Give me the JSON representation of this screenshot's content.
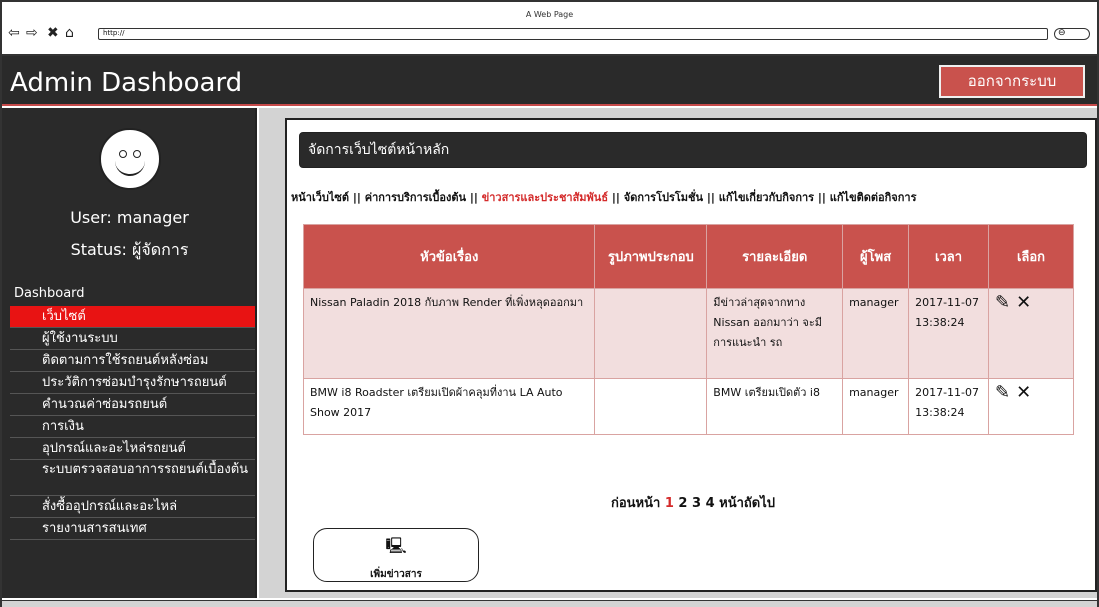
{
  "browser": {
    "title": "A Web Page",
    "url": "http://",
    "back_icon": "back-arrow-icon",
    "forward_icon": "forward-arrow-icon",
    "stop_icon": "close-icon",
    "home_icon": "home-icon",
    "search_icon": "search-icon"
  },
  "header": {
    "title": "Admin Dashboard",
    "logout_label": "ออกจากระบบ",
    "accent": "#c9524d"
  },
  "sidebar": {
    "user_line": "User: manager",
    "status_line": "Status: ผู้จัดการ",
    "section": "Dashboard",
    "items": [
      {
        "label": "เว็บไซต์",
        "active": true
      },
      {
        "label": "ผู้ใช้งานระบบ"
      },
      {
        "label": "ติดตามการใช้รถยนต์หลังซ่อม"
      },
      {
        "label": "ประวัติการซ่อมบำรุงรักษารถยนต์"
      },
      {
        "label": "คำนวณค่าซ่อมรถยนต์"
      },
      {
        "label": "การเงิน"
      },
      {
        "label": "อุปกรณ์และอะไหล่รถยนต์"
      },
      {
        "label": "ระบบตรวจสอบอาการรถยนต์เบื้องต้น"
      },
      {
        "label": "สั่งซื้ออุปกรณ์และอะไหล่"
      },
      {
        "label": "รายงานสารสนเทศ"
      }
    ]
  },
  "main": {
    "panel_title": "จัดการเว็บไซต์หน้าหลัก",
    "tabs": [
      {
        "label": "หน้าเว็บไซต์"
      },
      {
        "label": "ค่าการบริการเบื้องต้น"
      },
      {
        "label": "ข่าวสารและประชาสัมพันธ์",
        "active": true
      },
      {
        "label": "จัดการโปรโมชั่น"
      },
      {
        "label": "แก้ไขเกี่ยวกับกิจการ"
      },
      {
        "label": "แก้ไขติดต่อกิจการ"
      }
    ],
    "tab_separator": " || ",
    "table": {
      "headers": [
        "หัวข้อเรื่อง",
        "รูปภาพประกอบ",
        "รายละเอียด",
        "ผู้โพส",
        "เวลา",
        "เลือก"
      ],
      "rows": [
        {
          "title": "Nissan Paladin 2018 กับภาพ Render ที่เพิ่งหลุดออกมา",
          "image": "",
          "detail": "มีข่าวล่าสุดจากทาง Nissan ออกมาว่า จะมีการแนะนำ รถ",
          "poster": "manager",
          "time": "2017-11-07 13:38:24"
        },
        {
          "title": "BMW i8 Roadster เตรียมเปิดผ้าคลุมที่งาน LA Auto Show 2017",
          "image": "",
          "detail": "BMW เตรียมเปิดตัว i8",
          "poster": "manager",
          "time": "2017-11-07 13:38:24"
        }
      ],
      "edit_icon": "edit-icon",
      "delete_icon": "delete-icon"
    },
    "pager": {
      "prev": "ก่อนหน้า",
      "pages": [
        "1",
        "2",
        "3",
        "4"
      ],
      "current": "1",
      "next": "หน้าถัดไป"
    },
    "add_button": {
      "label": "เพิ่มข่าวสาร",
      "icon": "computer-icon"
    }
  }
}
